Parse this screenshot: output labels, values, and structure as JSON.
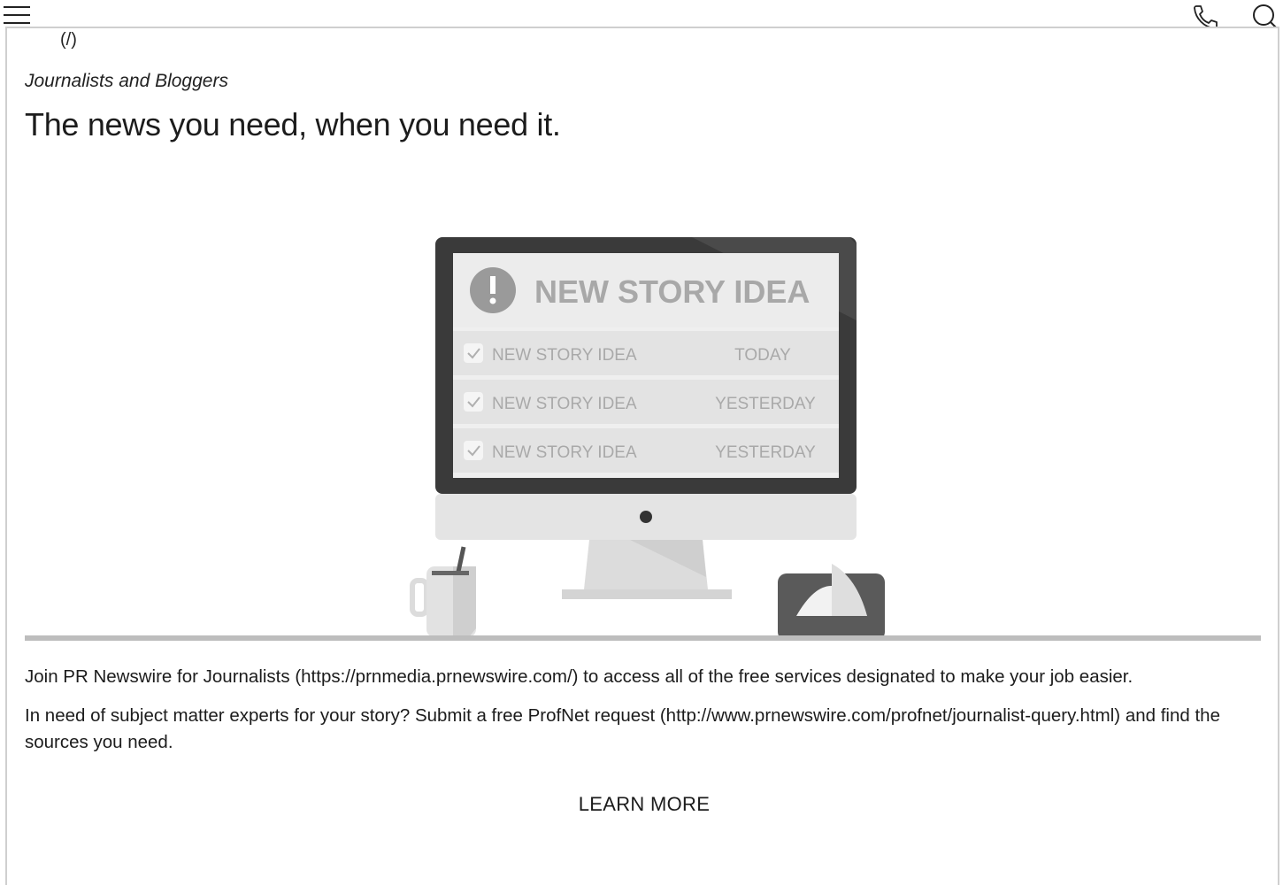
{
  "header": {
    "menu_icon": "hamburger-menu-icon",
    "phone_icon": "phone-icon",
    "search_icon": "search-icon"
  },
  "logo": {
    "link_text": "(/)"
  },
  "section": {
    "eyebrow": "Journalists and Bloggers",
    "headline": "The news you need, when you need it."
  },
  "illustration": {
    "banner": "NEW STORY IDEA",
    "rows": [
      {
        "title": "NEW STORY IDEA",
        "when": "TODAY"
      },
      {
        "title": "NEW STORY IDEA",
        "when": "YESTERDAY"
      },
      {
        "title": "NEW STORY IDEA",
        "when": "YESTERDAY"
      }
    ]
  },
  "body": {
    "para1_prefix": "Join PR Newswire for Journalists (",
    "para1_link": "https://prnmedia.prnewswire.com/",
    "para1_suffix": ") to access all of the free services designated to make your job easier.",
    "para2_prefix": "In need of subject matter experts for your story? Submit a free ProfNet request (",
    "para2_link": "http://www.prnewswire.com/profnet/journalist-query.html",
    "para2_suffix": ") and find the sources you need."
  },
  "cta": {
    "label": "LEARN MORE"
  },
  "colors": {
    "text": "#1c1c1c",
    "divider": "#bdbdbd",
    "card_border": "#cfcfcf",
    "monitor_frame": "#3a3a3a"
  }
}
